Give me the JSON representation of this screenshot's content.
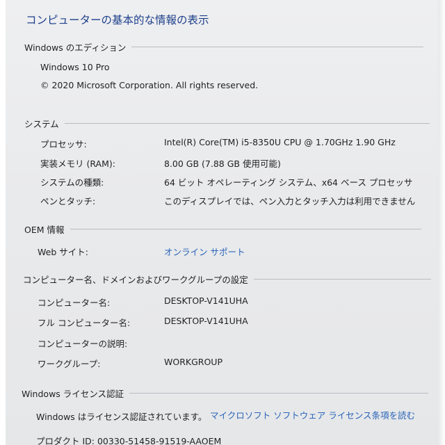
{
  "page_title": "コンピューターの基本的な情報の表示",
  "edition": {
    "header": "Windows のエディション",
    "name": "Windows 10 Pro",
    "copyright": "© 2020 Microsoft Corporation. All rights reserved."
  },
  "system": {
    "header": "システム",
    "rows": [
      {
        "label": "プロセッサ:",
        "value": "Intel(R) Core(TM) i5-8350U CPU @ 1.70GHz   1.90 GHz"
      },
      {
        "label": "実装メモリ (RAM):",
        "value": "8.00 GB (7.88 GB 使用可能)"
      },
      {
        "label": "システムの種類:",
        "value": "64 ビット オペレーティング システム、x64 ベース プロセッサ"
      },
      {
        "label": "ペンとタッチ:",
        "value": "このディスプレイでは、ペン入力とタッチ入力は利用できません"
      }
    ]
  },
  "oem": {
    "header": "OEM 情報",
    "web_label": "Web サイト:",
    "web_link": "オンライン サポート"
  },
  "computer_name": {
    "header": "コンピューター名、ドメインおよびワークグループの設定",
    "rows": [
      {
        "label": "コンピューター名:",
        "value": "DESKTOP-V141UHA"
      },
      {
        "label": "フル コンピューター名:",
        "value": "DESKTOP-V141UHA"
      },
      {
        "label": "コンピューターの説明:",
        "value": ""
      },
      {
        "label": "ワークグループ:",
        "value": "WORKGROUP"
      }
    ]
  },
  "license": {
    "header": "Windows ライセンス認証",
    "status": "Windows はライセンス認証されています。",
    "terms_link": "マイクロソフト ソフトウェア ライセンス条項を読む",
    "product_id": "プロダクト ID: 00330-51458-91519-AAOEM"
  },
  "colors": {
    "title": "#1c3f8a",
    "link": "#2a64b8",
    "background": "#eaebed",
    "rule": "#b9bcc1"
  }
}
